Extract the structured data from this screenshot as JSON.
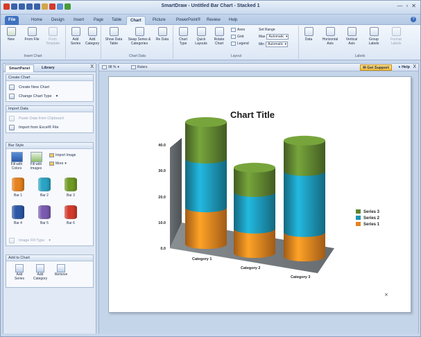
{
  "app": {
    "window_title": "SmartDraw - Untitled Bar Chart - Stacked 1",
    "window_controls": {
      "minimize": "—",
      "maximize": "▫",
      "close": "✕"
    }
  },
  "quick_access": [
    {
      "icon": "app-logo-icon",
      "color": "#d63a2a"
    },
    {
      "icon": "undo-icon",
      "color": "#3a62a8"
    },
    {
      "icon": "redo-icon",
      "color": "#3a62a8"
    },
    {
      "icon": "save-icon",
      "color": "#3a62a8"
    },
    {
      "icon": "new-icon",
      "color": "#3a62a8"
    },
    {
      "icon": "open-icon",
      "color": "#d2a64a"
    },
    {
      "icon": "print-icon",
      "color": "#d63a2a"
    },
    {
      "icon": "preview-icon",
      "color": "#5a8fd0"
    },
    {
      "icon": "export-icon",
      "color": "#4a9a3a"
    }
  ],
  "tabs": [
    "File",
    "Home",
    "Design",
    "Insert",
    "Page",
    "Table",
    "Chart",
    "Picture",
    "PowerPoint®",
    "Review",
    "Help"
  ],
  "active_tab": "Chart",
  "ribbon": {
    "insert_chart": {
      "label": "Insert Chart",
      "buttons": [
        "New",
        "From File",
        "From Template"
      ]
    },
    "edit": {
      "buttons": [
        "Add Series",
        "Add Category"
      ]
    },
    "chart_data": {
      "label": "Chart Data",
      "buttons": [
        "Show Data Table",
        "Swap Series & Categories",
        "Re Data"
      ]
    },
    "layout": {
      "label": "Layout",
      "buttons": [
        "Chart Type",
        "Quick Layouts",
        "Rotate Chart"
      ],
      "toggles": [
        "Axes",
        "Grid",
        "Legend"
      ],
      "set_range": "Set Range",
      "max_label": "Max",
      "min_label": "Min",
      "max_value": "Automatic",
      "min_value": "Automatic"
    },
    "labels": {
      "label": "Labels",
      "buttons": [
        "Data",
        "Horizontal Axis",
        "Vertical Axis",
        "Group Labels",
        "Format Labels"
      ]
    }
  },
  "left_panel": {
    "tabs": [
      "SmartPanel",
      "Library"
    ],
    "close": "X",
    "create_chart": {
      "header": "Create Chart",
      "items": [
        "Create New Chart",
        "Change Chart Type"
      ]
    },
    "import_data": {
      "header": "Import Data",
      "items": [
        "Paste Data from Clipboard",
        "Import from Excel® File"
      ]
    },
    "bar_style": {
      "header": "Bar Style",
      "fill_colors": "Fill with Colors",
      "fill_images": "Fill with Images",
      "import_image": "Import Image",
      "more": "More",
      "styles": [
        {
          "label": "Bar 1",
          "color": "#e6821f"
        },
        {
          "label": "Bar 2",
          "color": "#2aa4c4"
        },
        {
          "label": "Bar 3",
          "color": "#6f9a24"
        },
        {
          "label": "Bar 4",
          "color": "#2b57a6"
        },
        {
          "label": "Bar 5",
          "color": "#7a5bb0"
        },
        {
          "label": "Bar 6",
          "color": "#d33a2c"
        }
      ],
      "image_fill": "Image Fill Type"
    },
    "add_to_chart": {
      "header": "Add to Chart",
      "items": [
        "Add Series",
        "Add Category",
        "Remove"
      ]
    }
  },
  "canvas_toolbar": {
    "zoom": "98 %",
    "ruler": "Rulers",
    "get_support": "Get Support",
    "help": "Help",
    "close": "X"
  },
  "chart_data": {
    "type": "bar",
    "style": "3d-stacked-cylinder",
    "title": "Chart Title",
    "categories": [
      "Category 1",
      "Category 2",
      "Category 3"
    ],
    "series": [
      {
        "name": "Series 1",
        "color": "#e6821f",
        "values": [
          12,
          8,
          8
        ]
      },
      {
        "name": "Series 2",
        "color": "#1c94b4",
        "values": [
          16,
          12,
          20
        ]
      },
      {
        "name": "Series 3",
        "color": "#5f8430",
        "values": [
          12,
          8,
          10
        ]
      }
    ],
    "yticks": [
      "0.0",
      "10.0",
      "20.0",
      "30.0",
      "40.0"
    ],
    "ylim": [
      0,
      40
    ],
    "legend_position": "right"
  }
}
